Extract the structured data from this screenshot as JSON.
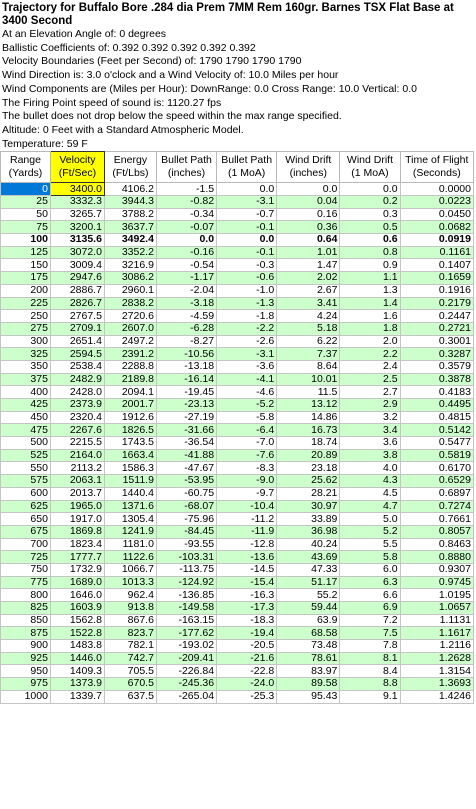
{
  "title": "Trajectory for Buffalo Bore .284 dia Prem 7MM Rem 160gr. Barnes TSX Flat Base at 3400 Second",
  "info_lines": [
    "At an Elevation Angle of: 0 degrees",
    "Ballistic Coefficients of: 0.392   0.392   0.392   0.392   0.392",
    "Velocity Boundaries (Feet per Second) of: 1790   1790   1790   1790",
    "Wind Direction is: 3.0 o'clock and a Wind Velocity of: 10.0 Miles per hour",
    "Wind Components are (Miles per Hour): DownRange: 0.0   Cross Range: 10.0   Vertical: 0.0",
    "The Firing Point speed of sound is: 1120.27 fps",
    "The bullet does not drop below the speed within the max range specified.",
    "Altitude: 0 Feet with a Standard Atmospheric Model.",
    "Temperature: 59 F"
  ],
  "columns": [
    {
      "line1": "Range",
      "line2": "(Yards)"
    },
    {
      "line1": "Velocity",
      "line2": "(Ft/Sec)"
    },
    {
      "line1": "Energy",
      "line2": "(Ft/Lbs)"
    },
    {
      "line1": "Bullet Path",
      "line2": "(inches)"
    },
    {
      "line1": "Bullet Path",
      "line2": "(1 MoA)"
    },
    {
      "line1": "Wind Drift",
      "line2": "(inches)"
    },
    {
      "line1": "Wind Drift",
      "line2": "(1 MoA)"
    },
    {
      "line1": "Time of Flight",
      "line2": "(Seconds)"
    }
  ],
  "rows": [
    [
      "0",
      "3400.0",
      "4106.2",
      "-1.5",
      "0.0",
      "0.0",
      "0.0",
      "0.0000"
    ],
    [
      "25",
      "3332.3",
      "3944.3",
      "-0.82",
      "-3.1",
      "0.04",
      "0.2",
      "0.0223"
    ],
    [
      "50",
      "3265.7",
      "3788.2",
      "-0.34",
      "-0.7",
      "0.16",
      "0.3",
      "0.0450"
    ],
    [
      "75",
      "3200.1",
      "3637.7",
      "-0.07",
      "-0.1",
      "0.36",
      "0.5",
      "0.0682"
    ],
    [
      "100",
      "3135.6",
      "3492.4",
      "0.0",
      "0.0",
      "0.64",
      "0.6",
      "0.0919"
    ],
    [
      "125",
      "3072.0",
      "3352.2",
      "-0.16",
      "-0.1",
      "1.01",
      "0.8",
      "0.1161"
    ],
    [
      "150",
      "3009.4",
      "3216.9",
      "-0.54",
      "-0.3",
      "1.47",
      "0.9",
      "0.1407"
    ],
    [
      "175",
      "2947.6",
      "3086.2",
      "-1.17",
      "-0.6",
      "2.02",
      "1.1",
      "0.1659"
    ],
    [
      "200",
      "2886.7",
      "2960.1",
      "-2.04",
      "-1.0",
      "2.67",
      "1.3",
      "0.1916"
    ],
    [
      "225",
      "2826.7",
      "2838.2",
      "-3.18",
      "-1.3",
      "3.41",
      "1.4",
      "0.2179"
    ],
    [
      "250",
      "2767.5",
      "2720.6",
      "-4.59",
      "-1.8",
      "4.24",
      "1.6",
      "0.2447"
    ],
    [
      "275",
      "2709.1",
      "2607.0",
      "-6.28",
      "-2.2",
      "5.18",
      "1.8",
      "0.2721"
    ],
    [
      "300",
      "2651.4",
      "2497.2",
      "-8.27",
      "-2.6",
      "6.22",
      "2.0",
      "0.3001"
    ],
    [
      "325",
      "2594.5",
      "2391.2",
      "-10.56",
      "-3.1",
      "7.37",
      "2.2",
      "0.3287"
    ],
    [
      "350",
      "2538.4",
      "2288.8",
      "-13.18",
      "-3.6",
      "8.64",
      "2.4",
      "0.3579"
    ],
    [
      "375",
      "2482.9",
      "2189.8",
      "-16.14",
      "-4.1",
      "10.01",
      "2.5",
      "0.3878"
    ],
    [
      "400",
      "2428.0",
      "2094.1",
      "-19.45",
      "-4.6",
      "11.5",
      "2.7",
      "0.4183"
    ],
    [
      "425",
      "2373.9",
      "2001.7",
      "-23.13",
      "-5.2",
      "13.12",
      "2.9",
      "0.4495"
    ],
    [
      "450",
      "2320.4",
      "1912.6",
      "-27.19",
      "-5.8",
      "14.86",
      "3.2",
      "0.4815"
    ],
    [
      "475",
      "2267.6",
      "1826.5",
      "-31.66",
      "-6.4",
      "16.73",
      "3.4",
      "0.5142"
    ],
    [
      "500",
      "2215.5",
      "1743.5",
      "-36.54",
      "-7.0",
      "18.74",
      "3.6",
      "0.5477"
    ],
    [
      "525",
      "2164.0",
      "1663.4",
      "-41.88",
      "-7.6",
      "20.89",
      "3.8",
      "0.5819"
    ],
    [
      "550",
      "2113.2",
      "1586.3",
      "-47.67",
      "-8.3",
      "23.18",
      "4.0",
      "0.6170"
    ],
    [
      "575",
      "2063.1",
      "1511.9",
      "-53.95",
      "-9.0",
      "25.62",
      "4.3",
      "0.6529"
    ],
    [
      "600",
      "2013.7",
      "1440.4",
      "-60.75",
      "-9.7",
      "28.21",
      "4.5",
      "0.6897"
    ],
    [
      "625",
      "1965.0",
      "1371.6",
      "-68.07",
      "-10.4",
      "30.97",
      "4.7",
      "0.7274"
    ],
    [
      "650",
      "1917.0",
      "1305.4",
      "-75.96",
      "-11.2",
      "33.89",
      "5.0",
      "0.7661"
    ],
    [
      "675",
      "1869.8",
      "1241.9",
      "-84.45",
      "-11.9",
      "36.98",
      "5.2",
      "0.8057"
    ],
    [
      "700",
      "1823.4",
      "1181.0",
      "-93.55",
      "-12.8",
      "40.24",
      "5.5",
      "0.8463"
    ],
    [
      "725",
      "1777.7",
      "1122.6",
      "-103.31",
      "-13.6",
      "43.69",
      "5.8",
      "0.8880"
    ],
    [
      "750",
      "1732.9",
      "1066.7",
      "-113.75",
      "-14.5",
      "47.33",
      "6.0",
      "0.9307"
    ],
    [
      "775",
      "1689.0",
      "1013.3",
      "-124.92",
      "-15.4",
      "51.17",
      "6.3",
      "0.9745"
    ],
    [
      "800",
      "1646.0",
      "962.4",
      "-136.85",
      "-16.3",
      "55.2",
      "6.6",
      "1.0195"
    ],
    [
      "825",
      "1603.9",
      "913.8",
      "-149.58",
      "-17.3",
      "59.44",
      "6.9",
      "1.0657"
    ],
    [
      "850",
      "1562.8",
      "867.6",
      "-163.15",
      "-18.3",
      "63.9",
      "7.2",
      "1.1131"
    ],
    [
      "875",
      "1522.8",
      "823.7",
      "-177.62",
      "-19.4",
      "68.58",
      "7.5",
      "1.1617"
    ],
    [
      "900",
      "1483.8",
      "782.1",
      "-193.02",
      "-20.5",
      "73.48",
      "7.8",
      "1.2116"
    ],
    [
      "925",
      "1446.0",
      "742.7",
      "-209.41",
      "-21.6",
      "78.61",
      "8.1",
      "1.2628"
    ],
    [
      "950",
      "1409.3",
      "705.5",
      "-226.84",
      "-22.8",
      "83.97",
      "8.4",
      "1.3154"
    ],
    [
      "975",
      "1373.9",
      "670.5",
      "-245.36",
      "-24.0",
      "89.58",
      "8.8",
      "1.3693"
    ],
    [
      "1000",
      "1339.7",
      "637.5",
      "-265.04",
      "-25.3",
      "95.43",
      "9.1",
      "1.4246"
    ]
  ],
  "colors": {
    "row_alt": "#ccffcc",
    "highlight": "#ffff00",
    "selection": "#0078d7"
  }
}
